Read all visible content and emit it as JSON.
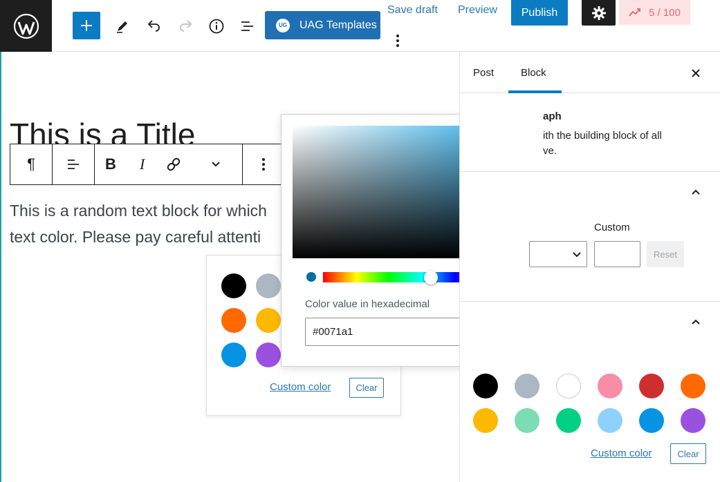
{
  "toolbar": {
    "uag_badge": "UG",
    "uag_label": "UAG Templates",
    "save_draft": "Save draft",
    "preview": "Preview",
    "publish": "Publish",
    "score": "5 / 100"
  },
  "editor": {
    "title": "This is a Title",
    "paragraph_line1": "This is a random text block for which",
    "paragraph_line2": "text color. Please pay careful attenti"
  },
  "block_toolbar": {
    "paragraph_symbol": "¶",
    "bold": "B",
    "italic": "I"
  },
  "swatch_popover": {
    "swatches": [
      "#000000",
      "#abb8c3",
      "#ff6900",
      "#fcb900",
      "#0693e3",
      "#9b51e0"
    ],
    "custom_color": "Custom color",
    "clear": "Clear"
  },
  "color_picker": {
    "hue_color": "#1ba3e3",
    "hex_label": "Color value in hexadecimal",
    "hex_value": "#0071a1"
  },
  "sidebar": {
    "tab_post": "Post",
    "tab_block": "Block",
    "block_name": "Paragraph",
    "block_name_visible": "aph",
    "block_desc_visible": "ith the building block of all\nve.",
    "custom_label": "Custom",
    "reset": "Reset",
    "palette": [
      "#000000",
      "#abb8c3",
      "#ffffff",
      "#f78da7",
      "#cf2e2e",
      "#ff6900",
      "#fcb900",
      "#7bdcb5",
      "#00d084",
      "#8ed1fc",
      "#0693e3",
      "#9b51e0"
    ],
    "custom_color": "Custom color",
    "clear": "Clear"
  },
  "icons": [
    "wordpress-logo-icon",
    "plus-icon",
    "pencil-icon",
    "undo-icon",
    "redo-icon",
    "info-icon",
    "list-view-icon",
    "more-vertical-icon",
    "gear-icon",
    "score-icon",
    "close-icon",
    "chevron-up-icon",
    "chevron-down-icon",
    "align-icon",
    "link-icon"
  ]
}
